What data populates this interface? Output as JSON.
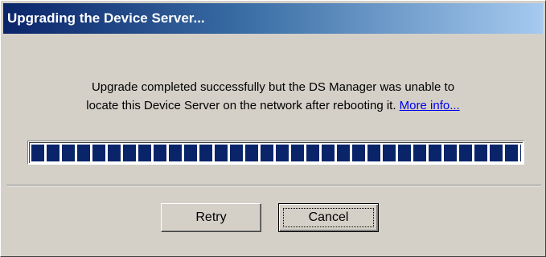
{
  "window": {
    "title": "Upgrading the Device Server..."
  },
  "message": {
    "text_line1": "Upgrade completed successfully but the DS Manager was unable to",
    "text_line2": "locate this Device Server on the network after rebooting it.",
    "link": "More info..."
  },
  "progress": {
    "percent": 100
  },
  "buttons": {
    "retry": "Retry",
    "cancel": "Cancel"
  },
  "colors": {
    "titlebar_start": "#0a246a",
    "titlebar_end": "#a6caf0",
    "face": "#d4d0c8",
    "progress_block": "#0a246a"
  }
}
